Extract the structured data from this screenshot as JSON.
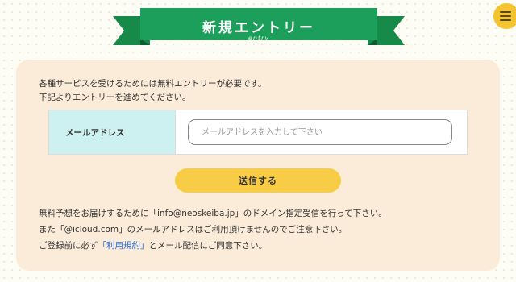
{
  "header": {
    "title": "新規エントリー",
    "subtitle": "entry",
    "ribbon_color": "#1c9f5a",
    "menu_icon": "hamburger-icon"
  },
  "intro": {
    "line1": "各種サービスを受けるためには無料エントリーが必要です。",
    "line2": "下記よりエントリーを進めてください。"
  },
  "form": {
    "email_label": "メールアドレス",
    "email_placeholder": "メールアドレスを入力して下さい",
    "email_value": "",
    "submit_label": "送信する"
  },
  "notes": {
    "line1": "無料予想をお届けするために「info@neoskeiba.jp」のドメイン指定受信を行って下さい。",
    "line2": "また「@icloud.com」のメールアドレスはご利用頂けませんのでご注意下さい。",
    "line3_prefix": "ご登録前に必ず",
    "terms_link": "「利用規約」",
    "line3_suffix": "とメール配信にご同意下さい。"
  },
  "colors": {
    "accent": "#f9cc45",
    "card_bg": "#fbecd9",
    "label_bg": "#cdf1f0",
    "link": "#2b6fd6"
  }
}
